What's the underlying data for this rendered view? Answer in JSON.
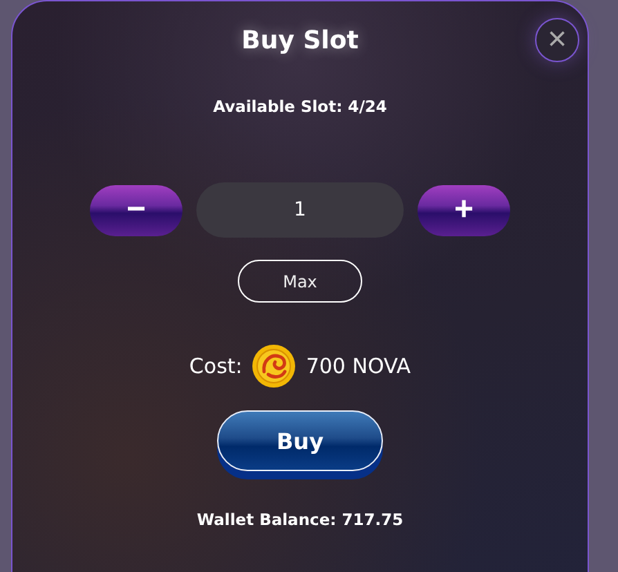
{
  "dialog": {
    "title": "Buy Slot",
    "close": "×"
  },
  "available": "Available Slot: 4/24",
  "stepper": {
    "decrement": "−",
    "value": "1",
    "increment": "+"
  },
  "max_button": "Max",
  "cost": {
    "label": "Cost:",
    "amount": "700 NOVA"
  },
  "buy_button": "Buy",
  "wallet_balance": "Wallet Balance: 717.75"
}
